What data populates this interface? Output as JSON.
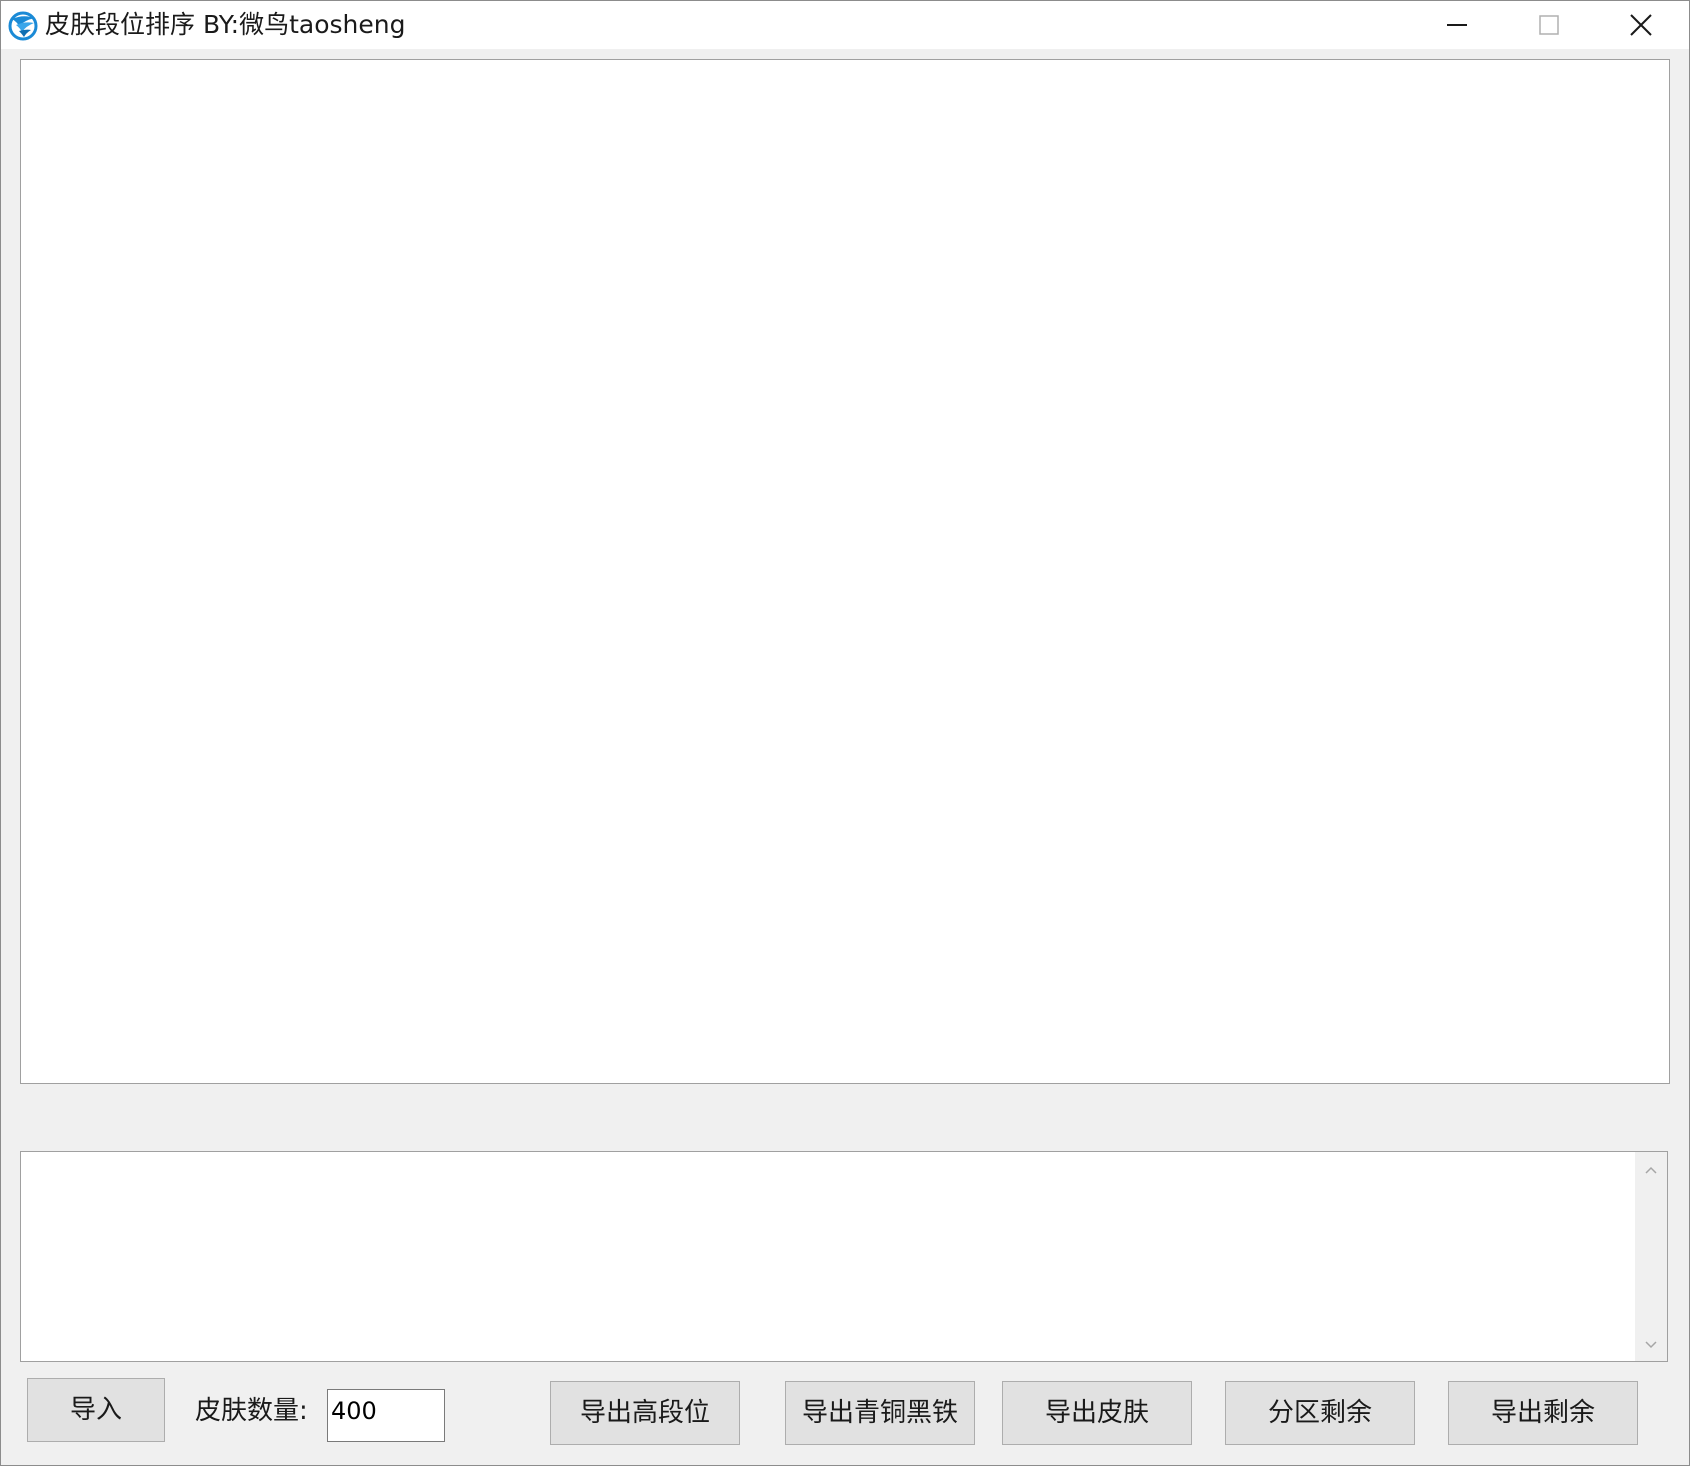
{
  "window": {
    "title": "皮肤段位排序  BY:微鸟taosheng",
    "app_icon": "bird-swirl-icon",
    "controls": [
      "minimize-icon",
      "maximize-icon",
      "close-icon"
    ]
  },
  "controls": {
    "import_label": "导入",
    "skin_count_label": "皮肤数量:",
    "skin_count_value": "400",
    "export_high_rank_label": "导出高段位",
    "export_bronze_iron_label": "导出青铜黑铁",
    "export_skins_label": "导出皮肤",
    "partition_remaining_label": "分区剩余",
    "export_remaining_label": "导出剩余"
  },
  "colors": {
    "window_bg": "#f0f0f0",
    "button_bg": "#e1e1e1",
    "icon_accent": "#1a8ad6"
  }
}
